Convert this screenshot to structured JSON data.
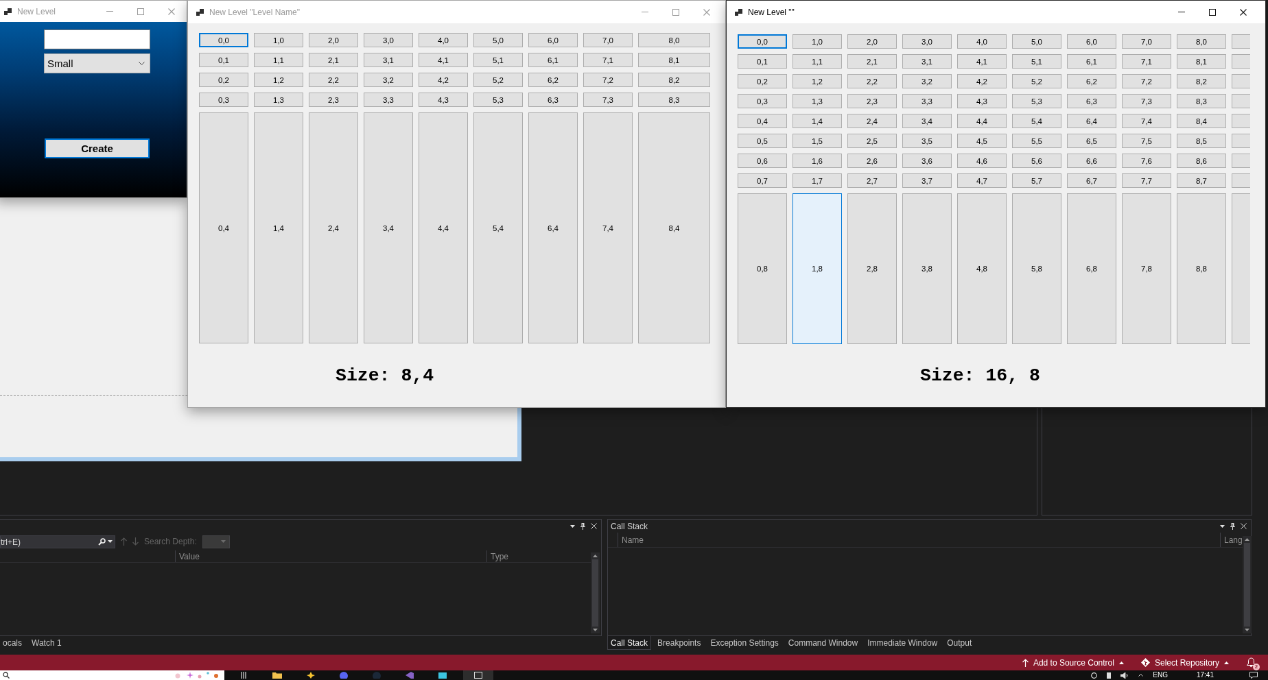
{
  "windows": [
    {
      "kind": "form",
      "title": "New Level",
      "active": false,
      "size_select": {
        "value": "Small"
      },
      "create_button": {
        "label": "Create",
        "focused": true
      }
    },
    {
      "kind": "grid",
      "title": "New Level \"Level Name\"",
      "active": false,
      "grid": {
        "partial_column": false,
        "rows": [
          [
            {
              "label": "0,0",
              "focused": true,
              "hovered": false
            },
            {
              "label": "1,0",
              "focused": false,
              "hovered": false
            },
            {
              "label": "2,0",
              "focused": false,
              "hovered": false
            },
            {
              "label": "3,0",
              "focused": false,
              "hovered": false
            },
            {
              "label": "4,0",
              "focused": false,
              "hovered": false
            },
            {
              "label": "5,0",
              "focused": false,
              "hovered": false
            },
            {
              "label": "6,0",
              "focused": false,
              "hovered": false
            },
            {
              "label": "7,0",
              "focused": false,
              "hovered": false
            },
            {
              "label": "8,0",
              "focused": false,
              "hovered": false
            }
          ],
          [
            {
              "label": "0,1",
              "focused": false,
              "hovered": false
            },
            {
              "label": "1,1",
              "focused": false,
              "hovered": false
            },
            {
              "label": "2,1",
              "focused": false,
              "hovered": false
            },
            {
              "label": "3,1",
              "focused": false,
              "hovered": false
            },
            {
              "label": "4,1",
              "focused": false,
              "hovered": false
            },
            {
              "label": "5,1",
              "focused": false,
              "hovered": false
            },
            {
              "label": "6,1",
              "focused": false,
              "hovered": false
            },
            {
              "label": "7,1",
              "focused": false,
              "hovered": false
            },
            {
              "label": "8,1",
              "focused": false,
              "hovered": false
            }
          ],
          [
            {
              "label": "0,2",
              "focused": false,
              "hovered": false
            },
            {
              "label": "1,2",
              "focused": false,
              "hovered": false
            },
            {
              "label": "2,2",
              "focused": false,
              "hovered": false
            },
            {
              "label": "3,2",
              "focused": false,
              "hovered": false
            },
            {
              "label": "4,2",
              "focused": false,
              "hovered": false
            },
            {
              "label": "5,2",
              "focused": false,
              "hovered": false
            },
            {
              "label": "6,2",
              "focused": false,
              "hovered": false
            },
            {
              "label": "7,2",
              "focused": false,
              "hovered": false
            },
            {
              "label": "8,2",
              "focused": false,
              "hovered": false
            }
          ],
          [
            {
              "label": "0,3",
              "focused": false,
              "hovered": false
            },
            {
              "label": "1,3",
              "focused": false,
              "hovered": false
            },
            {
              "label": "2,3",
              "focused": false,
              "hovered": false
            },
            {
              "label": "3,3",
              "focused": false,
              "hovered": false
            },
            {
              "label": "4,3",
              "focused": false,
              "hovered": false
            },
            {
              "label": "5,3",
              "focused": false,
              "hovered": false
            },
            {
              "label": "6,3",
              "focused": false,
              "hovered": false
            },
            {
              "label": "7,3",
              "focused": false,
              "hovered": false
            },
            {
              "label": "8,3",
              "focused": false,
              "hovered": false
            }
          ],
          [
            {
              "label": "0,4",
              "focused": false,
              "hovered": false
            },
            {
              "label": "1,4",
              "focused": false,
              "hovered": false
            },
            {
              "label": "2,4",
              "focused": false,
              "hovered": false
            },
            {
              "label": "3,4",
              "focused": false,
              "hovered": false
            },
            {
              "label": "4,4",
              "focused": false,
              "hovered": false
            },
            {
              "label": "5,4",
              "focused": false,
              "hovered": false
            },
            {
              "label": "6,4",
              "focused": false,
              "hovered": false
            },
            {
              "label": "7,4",
              "focused": false,
              "hovered": false
            },
            {
              "label": "8,4",
              "focused": false,
              "hovered": false
            }
          ]
        ]
      },
      "size_label": "Size: 8,4"
    },
    {
      "kind": "grid",
      "title": "New Level \"\"",
      "active": true,
      "grid": {
        "partial_column": true,
        "rows": [
          [
            {
              "label": "0,0",
              "focused": true,
              "hovered": false
            },
            {
              "label": "1,0",
              "focused": false,
              "hovered": false
            },
            {
              "label": "2,0",
              "focused": false,
              "hovered": false
            },
            {
              "label": "3,0",
              "focused": false,
              "hovered": false
            },
            {
              "label": "4,0",
              "focused": false,
              "hovered": false
            },
            {
              "label": "5,0",
              "focused": false,
              "hovered": false
            },
            {
              "label": "6,0",
              "focused": false,
              "hovered": false
            },
            {
              "label": "7,0",
              "focused": false,
              "hovered": false
            },
            {
              "label": "8,0",
              "focused": false,
              "hovered": false
            }
          ],
          [
            {
              "label": "0,1",
              "focused": false,
              "hovered": false
            },
            {
              "label": "1,1",
              "focused": false,
              "hovered": false
            },
            {
              "label": "2,1",
              "focused": false,
              "hovered": false
            },
            {
              "label": "3,1",
              "focused": false,
              "hovered": false
            },
            {
              "label": "4,1",
              "focused": false,
              "hovered": false
            },
            {
              "label": "5,1",
              "focused": false,
              "hovered": false
            },
            {
              "label": "6,1",
              "focused": false,
              "hovered": false
            },
            {
              "label": "7,1",
              "focused": false,
              "hovered": false
            },
            {
              "label": "8,1",
              "focused": false,
              "hovered": false
            }
          ],
          [
            {
              "label": "0,2",
              "focused": false,
              "hovered": false
            },
            {
              "label": "1,2",
              "focused": false,
              "hovered": false
            },
            {
              "label": "2,2",
              "focused": false,
              "hovered": false
            },
            {
              "label": "3,2",
              "focused": false,
              "hovered": false
            },
            {
              "label": "4,2",
              "focused": false,
              "hovered": false
            },
            {
              "label": "5,2",
              "focused": false,
              "hovered": false
            },
            {
              "label": "6,2",
              "focused": false,
              "hovered": false
            },
            {
              "label": "7,2",
              "focused": false,
              "hovered": false
            },
            {
              "label": "8,2",
              "focused": false,
              "hovered": false
            }
          ],
          [
            {
              "label": "0,3",
              "focused": false,
              "hovered": false
            },
            {
              "label": "1,3",
              "focused": false,
              "hovered": false
            },
            {
              "label": "2,3",
              "focused": false,
              "hovered": false
            },
            {
              "label": "3,3",
              "focused": false,
              "hovered": false
            },
            {
              "label": "4,3",
              "focused": false,
              "hovered": false
            },
            {
              "label": "5,3",
              "focused": false,
              "hovered": false
            },
            {
              "label": "6,3",
              "focused": false,
              "hovered": false
            },
            {
              "label": "7,3",
              "focused": false,
              "hovered": false
            },
            {
              "label": "8,3",
              "focused": false,
              "hovered": false
            }
          ],
          [
            {
              "label": "0,4",
              "focused": false,
              "hovered": false
            },
            {
              "label": "1,4",
              "focused": false,
              "hovered": false
            },
            {
              "label": "2,4",
              "focused": false,
              "hovered": false
            },
            {
              "label": "3,4",
              "focused": false,
              "hovered": false
            },
            {
              "label": "4,4",
              "focused": false,
              "hovered": false
            },
            {
              "label": "5,4",
              "focused": false,
              "hovered": false
            },
            {
              "label": "6,4",
              "focused": false,
              "hovered": false
            },
            {
              "label": "7,4",
              "focused": false,
              "hovered": false
            },
            {
              "label": "8,4",
              "focused": false,
              "hovered": false
            }
          ],
          [
            {
              "label": "0,5",
              "focused": false,
              "hovered": false
            },
            {
              "label": "1,5",
              "focused": false,
              "hovered": false
            },
            {
              "label": "2,5",
              "focused": false,
              "hovered": false
            },
            {
              "label": "3,5",
              "focused": false,
              "hovered": false
            },
            {
              "label": "4,5",
              "focused": false,
              "hovered": false
            },
            {
              "label": "5,5",
              "focused": false,
              "hovered": false
            },
            {
              "label": "6,5",
              "focused": false,
              "hovered": false
            },
            {
              "label": "7,5",
              "focused": false,
              "hovered": false
            },
            {
              "label": "8,5",
              "focused": false,
              "hovered": false
            }
          ],
          [
            {
              "label": "0,6",
              "focused": false,
              "hovered": false
            },
            {
              "label": "1,6",
              "focused": false,
              "hovered": false
            },
            {
              "label": "2,6",
              "focused": false,
              "hovered": false
            },
            {
              "label": "3,6",
              "focused": false,
              "hovered": false
            },
            {
              "label": "4,6",
              "focused": false,
              "hovered": false
            },
            {
              "label": "5,6",
              "focused": false,
              "hovered": false
            },
            {
              "label": "6,6",
              "focused": false,
              "hovered": false
            },
            {
              "label": "7,6",
              "focused": false,
              "hovered": false
            },
            {
              "label": "8,6",
              "focused": false,
              "hovered": false
            }
          ],
          [
            {
              "label": "0,7",
              "focused": false,
              "hovered": false
            },
            {
              "label": "1,7",
              "focused": false,
              "hovered": false
            },
            {
              "label": "2,7",
              "focused": false,
              "hovered": false
            },
            {
              "label": "3,7",
              "focused": false,
              "hovered": false
            },
            {
              "label": "4,7",
              "focused": false,
              "hovered": false
            },
            {
              "label": "5,7",
              "focused": false,
              "hovered": false
            },
            {
              "label": "6,7",
              "focused": false,
              "hovered": false
            },
            {
              "label": "7,7",
              "focused": false,
              "hovered": false
            },
            {
              "label": "8,7",
              "focused": false,
              "hovered": false
            }
          ],
          [
            {
              "label": "0,8",
              "focused": false,
              "hovered": false
            },
            {
              "label": "1,8",
              "focused": false,
              "hovered": true
            },
            {
              "label": "2,8",
              "focused": false,
              "hovered": false
            },
            {
              "label": "3,8",
              "focused": false,
              "hovered": false
            },
            {
              "label": "4,8",
              "focused": false,
              "hovered": false
            },
            {
              "label": "5,8",
              "focused": false,
              "hovered": false
            },
            {
              "label": "6,8",
              "focused": false,
              "hovered": false
            },
            {
              "label": "7,8",
              "focused": false,
              "hovered": false
            },
            {
              "label": "8,8",
              "focused": false,
              "hovered": false
            }
          ]
        ]
      },
      "size_label": "Size: 16, 8"
    }
  ],
  "locals_panel": {
    "search": {
      "placeholder": "trl+E)"
    },
    "search_depth_label": "Search Depth:",
    "columns": [
      "Value",
      "Type"
    ],
    "tabs": [
      {
        "label": "ocals",
        "selected": false
      },
      {
        "label": "Watch 1",
        "selected": false
      }
    ]
  },
  "call_stack_panel": {
    "title": "Call Stack",
    "columns": [
      "Name",
      "Lang"
    ],
    "tabs": [
      {
        "label": "Call Stack",
        "selected": true
      },
      {
        "label": "Breakpoints",
        "selected": false
      },
      {
        "label": "Exception Settings",
        "selected": false
      },
      {
        "label": "Command Window",
        "selected": false
      },
      {
        "label": "Immediate Window",
        "selected": false
      },
      {
        "label": "Output",
        "selected": false
      }
    ]
  },
  "status_bar": {
    "items": [
      {
        "kind": "source_control",
        "label": "Add to Source Control"
      },
      {
        "kind": "repository",
        "label": "Select Repository"
      }
    ],
    "notification_count": "2"
  },
  "taskbar": {
    "language": "ENG",
    "time": "17:41"
  }
}
